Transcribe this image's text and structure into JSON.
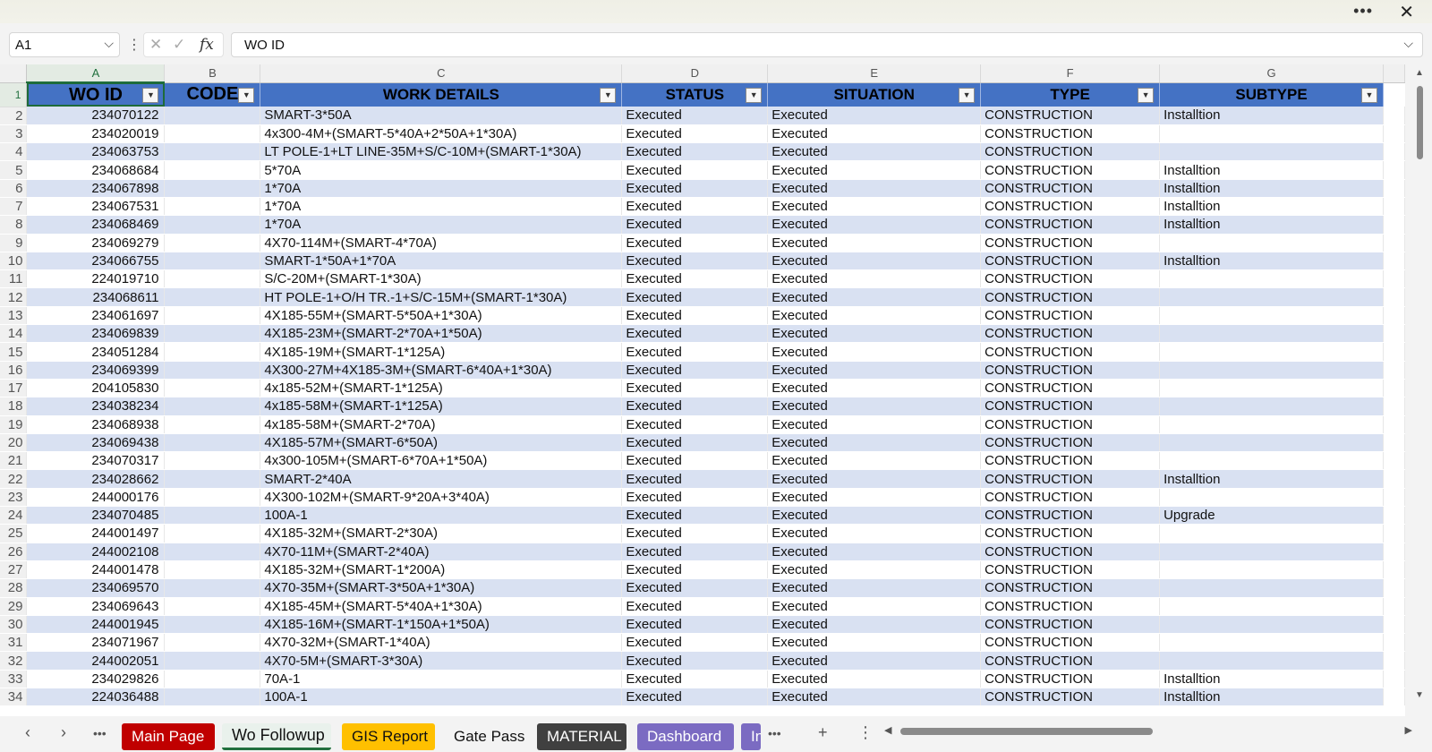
{
  "window": {
    "more_icon": "more-icon",
    "close_icon": "close-icon"
  },
  "formula_bar": {
    "name_box": "A1",
    "content": "WO ID"
  },
  "columns": [
    "A",
    "B",
    "C",
    "D",
    "E",
    "F",
    "G"
  ],
  "headers": [
    "WO ID",
    "CODE",
    "WORK DETAILS",
    "STATUS",
    "SITUATION",
    "TYPE",
    "SUBTYPE"
  ],
  "rows": [
    {
      "n": "2",
      "wo": "234070122",
      "code": "",
      "details": "SMART-3*50A",
      "status": "Executed",
      "situation": "Executed",
      "type": "CONSTRUCTION",
      "subtype": "Installtion"
    },
    {
      "n": "3",
      "wo": "234020019",
      "code": "",
      "details": "4x300-4M+(SMART-5*40A+2*50A+1*30A)",
      "status": "Executed",
      "situation": "Executed",
      "type": "CONSTRUCTION",
      "subtype": ""
    },
    {
      "n": "4",
      "wo": "234063753",
      "code": "",
      "details": "LT POLE-1+LT LINE-35M+S/C-10M+(SMART-1*30A)",
      "status": "Executed",
      "situation": "Executed",
      "type": "CONSTRUCTION",
      "subtype": ""
    },
    {
      "n": "5",
      "wo": "234068684",
      "code": "",
      "details": "5*70A",
      "status": "Executed",
      "situation": "Executed",
      "type": "CONSTRUCTION",
      "subtype": "Installtion"
    },
    {
      "n": "6",
      "wo": "234067898",
      "code": "",
      "details": "1*70A",
      "status": "Executed",
      "situation": "Executed",
      "type": "CONSTRUCTION",
      "subtype": "Installtion"
    },
    {
      "n": "7",
      "wo": "234067531",
      "code": "",
      "details": "1*70A",
      "status": "Executed",
      "situation": "Executed",
      "type": "CONSTRUCTION",
      "subtype": "Installtion"
    },
    {
      "n": "8",
      "wo": "234068469",
      "code": "",
      "details": "1*70A",
      "status": "Executed",
      "situation": "Executed",
      "type": "CONSTRUCTION",
      "subtype": "Installtion"
    },
    {
      "n": "9",
      "wo": "234069279",
      "code": "",
      "details": "4X70-114M+(SMART-4*70A)",
      "status": "Executed",
      "situation": "Executed",
      "type": "CONSTRUCTION",
      "subtype": ""
    },
    {
      "n": "10",
      "wo": "234066755",
      "code": "",
      "details": "SMART-1*50A+1*70A",
      "status": "Executed",
      "situation": "Executed",
      "type": "CONSTRUCTION",
      "subtype": "Installtion"
    },
    {
      "n": "11",
      "wo": "224019710",
      "code": "",
      "details": "S/C-20M+(SMART-1*30A)",
      "status": "Executed",
      "situation": "Executed",
      "type": "CONSTRUCTION",
      "subtype": ""
    },
    {
      "n": "12",
      "wo": "234068611",
      "code": "",
      "details": "HT POLE-1+O/H TR.-1+S/C-15M+(SMART-1*30A)",
      "status": "Executed",
      "situation": "Executed",
      "type": "CONSTRUCTION",
      "subtype": ""
    },
    {
      "n": "13",
      "wo": "234061697",
      "code": "",
      "details": "4X185-55M+(SMART-5*50A+1*30A)",
      "status": "Executed",
      "situation": "Executed",
      "type": "CONSTRUCTION",
      "subtype": ""
    },
    {
      "n": "14",
      "wo": "234069839",
      "code": "",
      "details": "4X185-23M+(SMART-2*70A+1*50A)",
      "status": "Executed",
      "situation": "Executed",
      "type": "CONSTRUCTION",
      "subtype": ""
    },
    {
      "n": "15",
      "wo": "234051284",
      "code": "",
      "details": "4X185-19M+(SMART-1*125A)",
      "status": "Executed",
      "situation": "Executed",
      "type": "CONSTRUCTION",
      "subtype": ""
    },
    {
      "n": "16",
      "wo": "234069399",
      "code": "",
      "details": "4X300-27M+4X185-3M+(SMART-6*40A+1*30A)",
      "status": "Executed",
      "situation": "Executed",
      "type": "CONSTRUCTION",
      "subtype": ""
    },
    {
      "n": "17",
      "wo": "204105830",
      "code": "",
      "details": "4x185-52M+(SMART-1*125A)",
      "status": "Executed",
      "situation": "Executed",
      "type": "CONSTRUCTION",
      "subtype": ""
    },
    {
      "n": "18",
      "wo": "234038234",
      "code": "",
      "details": "4x185-58M+(SMART-1*125A)",
      "status": "Executed",
      "situation": "Executed",
      "type": "CONSTRUCTION",
      "subtype": ""
    },
    {
      "n": "19",
      "wo": "234068938",
      "code": "",
      "details": "4x185-58M+(SMART-2*70A)",
      "status": "Executed",
      "situation": "Executed",
      "type": "CONSTRUCTION",
      "subtype": ""
    },
    {
      "n": "20",
      "wo": "234069438",
      "code": "",
      "details": "4X185-57M+(SMART-6*50A)",
      "status": "Executed",
      "situation": "Executed",
      "type": "CONSTRUCTION",
      "subtype": ""
    },
    {
      "n": "21",
      "wo": "234070317",
      "code": "",
      "details": "4x300-105M+(SMART-6*70A+1*50A)",
      "status": "Executed",
      "situation": "Executed",
      "type": "CONSTRUCTION",
      "subtype": ""
    },
    {
      "n": "22",
      "wo": "234028662",
      "code": "",
      "details": "SMART-2*40A",
      "status": "Executed",
      "situation": "Executed",
      "type": "CONSTRUCTION",
      "subtype": "Installtion"
    },
    {
      "n": "23",
      "wo": "244000176",
      "code": "",
      "details": "4X300-102M+(SMART-9*20A+3*40A)",
      "status": "Executed",
      "situation": "Executed",
      "type": "CONSTRUCTION",
      "subtype": ""
    },
    {
      "n": "24",
      "wo": "234070485",
      "code": "",
      "details": "100A-1",
      "status": "Executed",
      "situation": "Executed",
      "type": "CONSTRUCTION",
      "subtype": "Upgrade"
    },
    {
      "n": "25",
      "wo": "244001497",
      "code": "",
      "details": "4X185-32M+(SMART-2*30A)",
      "status": "Executed",
      "situation": "Executed",
      "type": "CONSTRUCTION",
      "subtype": ""
    },
    {
      "n": "26",
      "wo": "244002108",
      "code": "",
      "details": "4X70-11M+(SMART-2*40A)",
      "status": "Executed",
      "situation": "Executed",
      "type": "CONSTRUCTION",
      "subtype": ""
    },
    {
      "n": "27",
      "wo": "244001478",
      "code": "",
      "details": "4X185-32M+(SMART-1*200A)",
      "status": "Executed",
      "situation": "Executed",
      "type": "CONSTRUCTION",
      "subtype": ""
    },
    {
      "n": "28",
      "wo": "234069570",
      "code": "",
      "details": "4X70-35M+(SMART-3*50A+1*30A)",
      "status": "Executed",
      "situation": "Executed",
      "type": "CONSTRUCTION",
      "subtype": ""
    },
    {
      "n": "29",
      "wo": "234069643",
      "code": "",
      "details": "4X185-45M+(SMART-5*40A+1*30A)",
      "status": "Executed",
      "situation": "Executed",
      "type": "CONSTRUCTION",
      "subtype": ""
    },
    {
      "n": "30",
      "wo": "244001945",
      "code": "",
      "details": "4X185-16M+(SMART-1*150A+1*50A)",
      "status": "Executed",
      "situation": "Executed",
      "type": "CONSTRUCTION",
      "subtype": ""
    },
    {
      "n": "31",
      "wo": "234071967",
      "code": "",
      "details": "4X70-32M+(SMART-1*40A)",
      "status": "Executed",
      "situation": "Executed",
      "type": "CONSTRUCTION",
      "subtype": ""
    },
    {
      "n": "32",
      "wo": "244002051",
      "code": "",
      "details": "4X70-5M+(SMART-3*30A)",
      "status": "Executed",
      "situation": "Executed",
      "type": "CONSTRUCTION",
      "subtype": ""
    },
    {
      "n": "33",
      "wo": "234029826",
      "code": "",
      "details": "70A-1",
      "status": "Executed",
      "situation": "Executed",
      "type": "CONSTRUCTION",
      "subtype": "Installtion"
    },
    {
      "n": "34",
      "wo": "224036488",
      "code": "",
      "details": "100A-1",
      "status": "Executed",
      "situation": "Executed",
      "type": "CONSTRUCTION",
      "subtype": "Installtion"
    }
  ],
  "tabs": [
    {
      "label": "Main Page",
      "bg": "#c00000",
      "fg": "#ffffff"
    },
    {
      "label": "Wo Followup",
      "bg": "#e9f1ec",
      "fg": "#111111",
      "active": true
    },
    {
      "label": "GIS Report",
      "bg": "#ffc000",
      "fg": "#111111"
    },
    {
      "label": "Gate Pass",
      "bg": "#f3f3f3",
      "fg": "#111111"
    },
    {
      "label": "MATERIAL",
      "bg": "#404040",
      "fg": "#ffffff"
    },
    {
      "label": "Dashboard",
      "bg": "#7b6bc2",
      "fg": "#ffffff"
    },
    {
      "label": "In",
      "bg": "#7b6bc2",
      "fg": "#ffffff"
    }
  ],
  "colors": {
    "header_blue": "#4472c4",
    "band_blue": "#d9e1f2",
    "excel_green": "#21703e"
  }
}
